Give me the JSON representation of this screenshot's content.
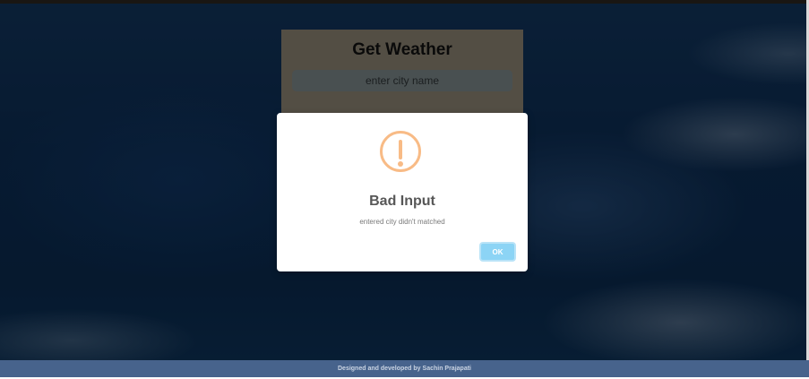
{
  "weather_card": {
    "title": "Get Weather",
    "city_input_placeholder": "enter city name",
    "city_input_value": ""
  },
  "alert": {
    "icon": "warning-icon",
    "title": "Bad Input",
    "message": "entered city didn't matched",
    "ok_label": "OK"
  },
  "footer": {
    "text": "Designed and developed by Sachin Prajapati"
  },
  "colors": {
    "warning_accent": "#f8bb86",
    "ok_button": "#8cd4f5",
    "footer_bg": "#47638c"
  }
}
